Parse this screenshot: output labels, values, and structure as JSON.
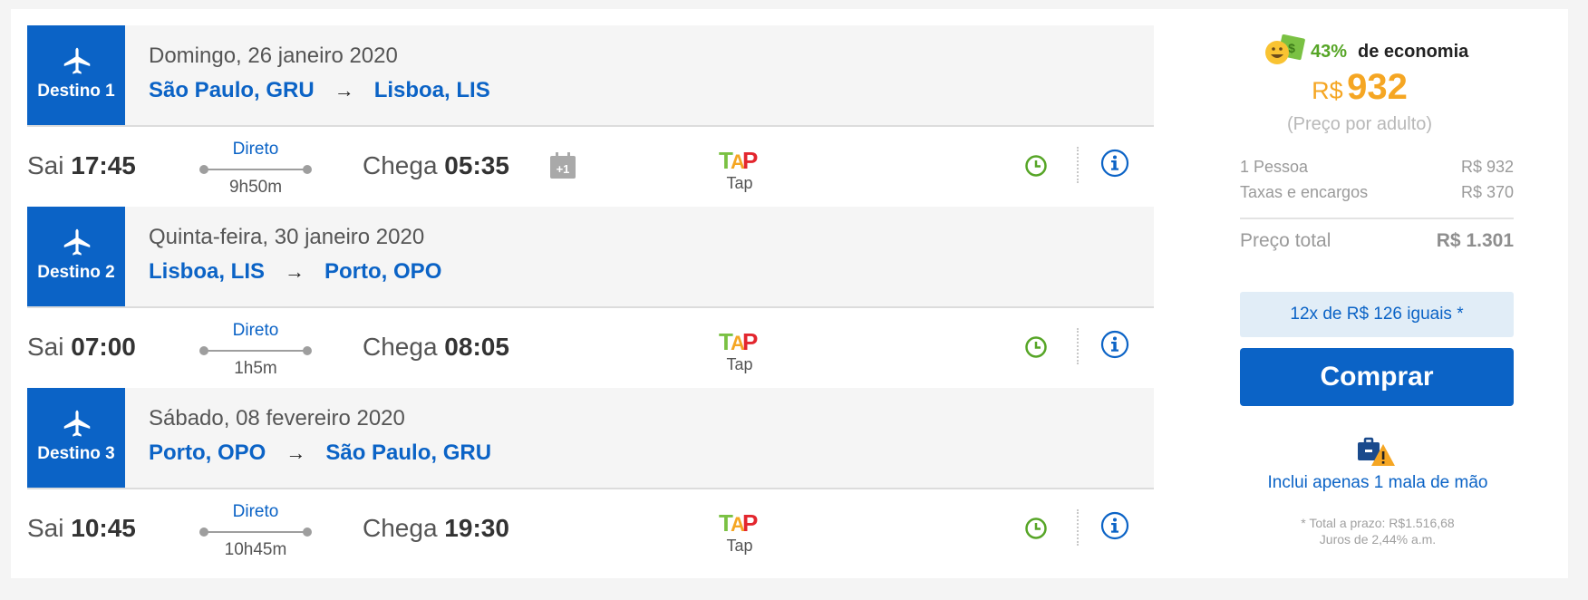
{
  "legs": [
    {
      "dest_label": "Destino 1",
      "date": "Domingo, 26 janeiro 2020",
      "origin": "São Paulo, GRU",
      "destination": "Lisboa, LIS",
      "depart_label": "Sai",
      "depart_time": "17:45",
      "stops": "Direto",
      "duration": "9h50m",
      "arrive_label": "Chega",
      "arrive_time": "05:35",
      "plus_day": "+1",
      "airline": "Tap"
    },
    {
      "dest_label": "Destino 2",
      "date": "Quinta-feira, 30 janeiro 2020",
      "origin": "Lisboa, LIS",
      "destination": "Porto, OPO",
      "depart_label": "Sai",
      "depart_time": "07:00",
      "stops": "Direto",
      "duration": "1h5m",
      "arrive_label": "Chega",
      "arrive_time": "08:05",
      "airline": "Tap"
    },
    {
      "dest_label": "Destino 3",
      "date": "Sábado, 08 fevereiro 2020",
      "origin": "Porto, OPO",
      "destination": "São Paulo, GRU",
      "depart_label": "Sai",
      "depart_time": "10:45",
      "stops": "Direto",
      "duration": "10h45m",
      "arrive_label": "Chega",
      "arrive_time": "19:30",
      "airline": "Tap"
    }
  ],
  "summary": {
    "savings_pct": "43%",
    "savings_text": "de economia",
    "currency": "R$",
    "price": "932",
    "per_adult": "(Preço por adulto)",
    "breakdown": [
      {
        "label": "1 Pessoa",
        "value": "R$ 932"
      },
      {
        "label": "Taxas e encargos",
        "value": "R$ 370"
      }
    ],
    "total_label": "Preço total",
    "total_value": "R$ 1.301",
    "installments": "12x de R$ 126 iguais *",
    "buy_label": "Comprar",
    "carry_on": "Inclui apenas 1 mala de mão",
    "terms_line1": "* Total a prazo: R$1.516,68",
    "terms_line2": "Juros de 2,44% a.m."
  },
  "colors": {
    "brand_blue": "#0b63c6",
    "price_orange": "#f5a623",
    "savings_green": "#56a526"
  },
  "icons": [
    "plane-icon",
    "plus-one-day-icon",
    "tap-logo",
    "clock-icon",
    "info-icon",
    "savings-emoji-icon",
    "baggage-warning-icon"
  ]
}
